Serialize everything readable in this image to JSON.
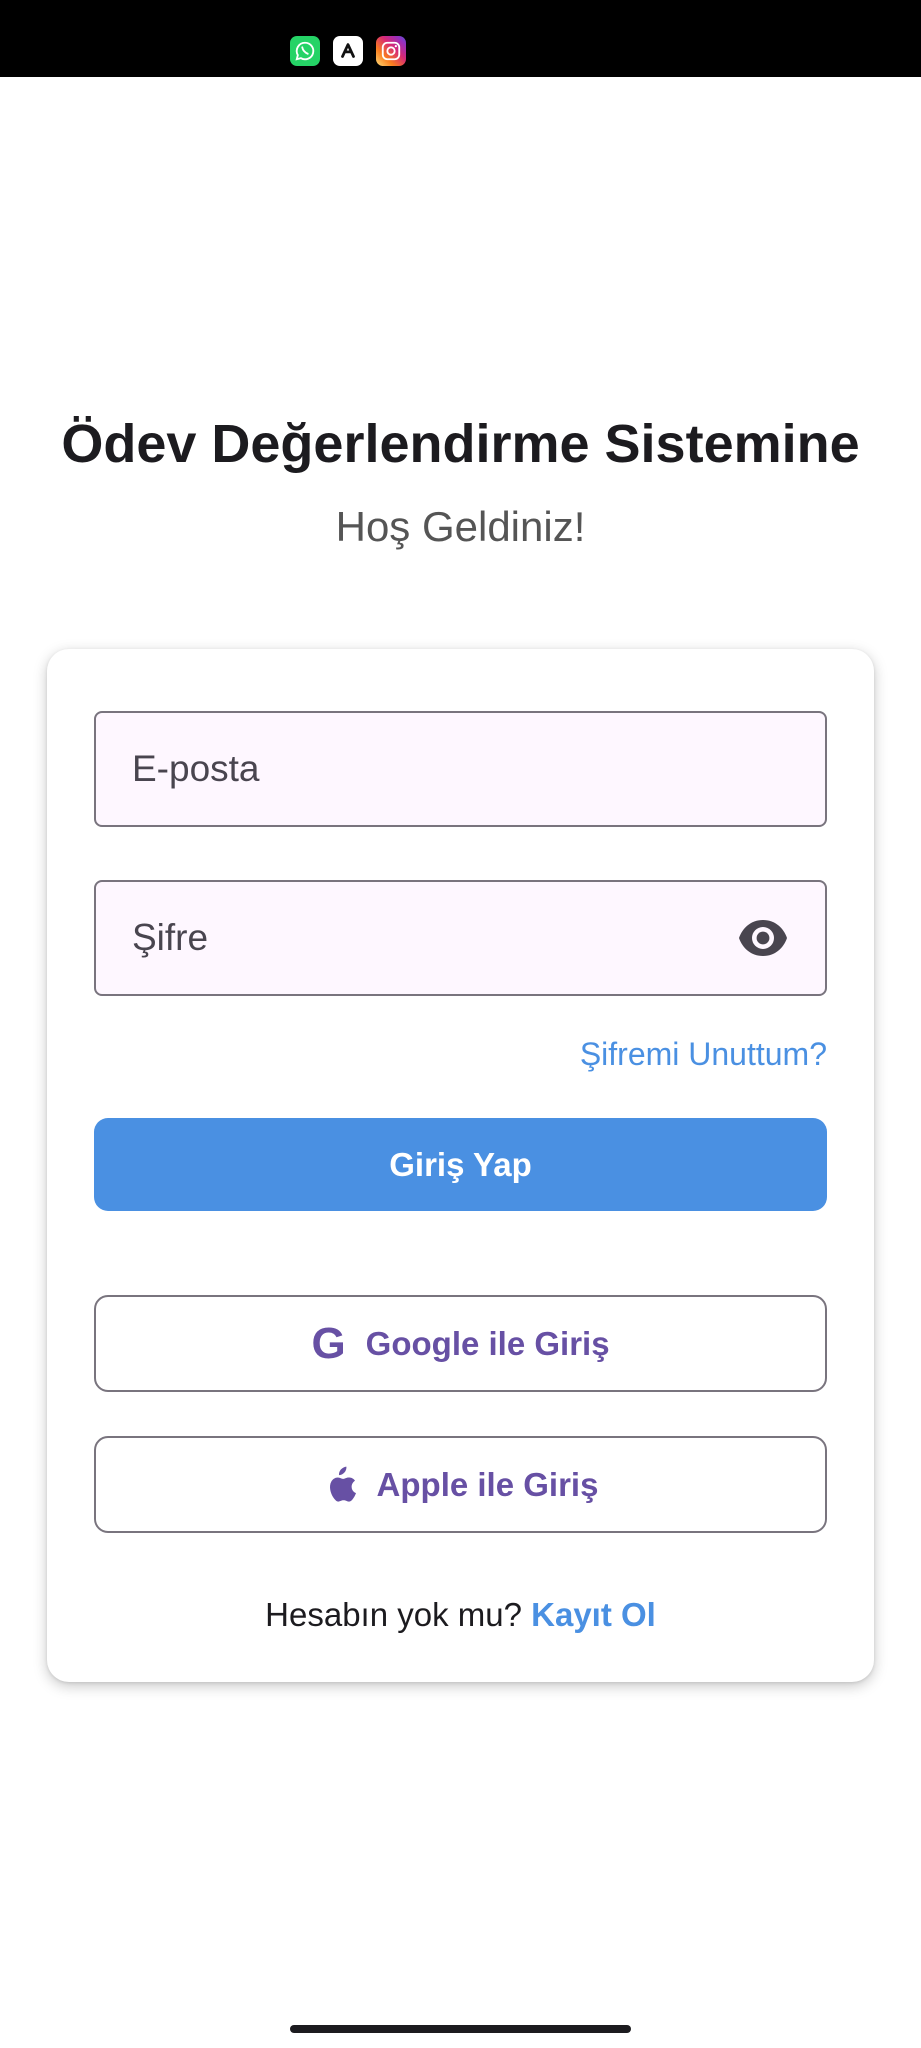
{
  "status_bar": {
    "notifications": [
      "whatsapp-icon",
      "app-icon",
      "instagram-icon"
    ]
  },
  "header": {
    "title": "Ödev Değerlendirme Sistemine",
    "subtitle": "Hoş Geldiniz!"
  },
  "form": {
    "email_placeholder": "E-posta",
    "password_placeholder": "Şifre",
    "forgot_password": "Şifremi Unuttum?",
    "login_button": "Giriş Yap",
    "google_button": "Google ile Giriş",
    "apple_button": "Apple ile Giriş",
    "no_account_text": "Hesabın yok mu?",
    "signup_link": "Kayıt Ol"
  },
  "colors": {
    "primary": "#4a90e2",
    "social_text": "#6750a4",
    "field_background": "#fef7ff",
    "field_border": "#79747e"
  }
}
